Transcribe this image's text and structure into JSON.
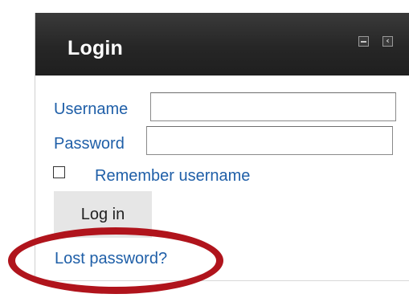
{
  "block": {
    "title": "Login",
    "controls": [
      {
        "icon": "minimize-icon"
      },
      {
        "icon": "dock-left-icon"
      }
    ]
  },
  "form": {
    "username_label": "Username",
    "username_value": "",
    "password_label": "Password",
    "password_value": "",
    "remember_label": "Remember username",
    "remember_checked": false,
    "login_button": "Log in",
    "lost_password_link": "Lost password?"
  },
  "annotation": {
    "type": "highlight-oval",
    "color": "#b0141c"
  },
  "colors": {
    "header_bg": "#262626",
    "link": "#1f5fa8"
  }
}
